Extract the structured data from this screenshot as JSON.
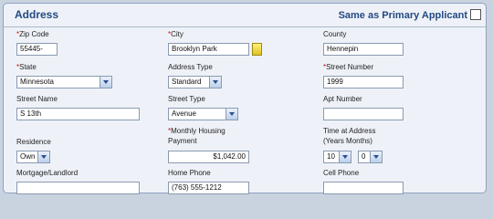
{
  "header": {
    "title": "Address",
    "same_as_primary_label": "Same as Primary Applicant"
  },
  "fields": {
    "zip_code": {
      "label": "*Zip Code",
      "value": "55445-"
    },
    "city": {
      "label": "*City",
      "value": "Brooklyn Park"
    },
    "county": {
      "label": "County",
      "value": "Hennepin"
    },
    "state": {
      "label": "*State",
      "value": "Minnesota"
    },
    "address_type": {
      "label": "Address Type",
      "value": "Standard"
    },
    "street_number": {
      "label": "*Street Number",
      "value": "1999"
    },
    "street_name": {
      "label": "Street Name",
      "value": "S 13th"
    },
    "street_type": {
      "label": "Street Type",
      "value": "Avenue"
    },
    "apt_number": {
      "label": "Apt Number",
      "value": ""
    },
    "residence": {
      "label": "Residence",
      "value": "Own"
    },
    "monthly_housing_payment": {
      "label_line1": "*Monthly Housing",
      "label_line2": "Payment",
      "value": "$1,042.00"
    },
    "time_at_address": {
      "label_line1": "Time at Address",
      "label_line2": "(Years Months)",
      "years": "10",
      "months": "0"
    },
    "mortgage_landlord": {
      "label": "Mortgage/Landlord",
      "value": ""
    },
    "home_phone": {
      "label": "Home Phone",
      "value": "(763) 555-1212"
    },
    "cell_phone": {
      "label": "Cell Phone",
      "value": ""
    }
  }
}
